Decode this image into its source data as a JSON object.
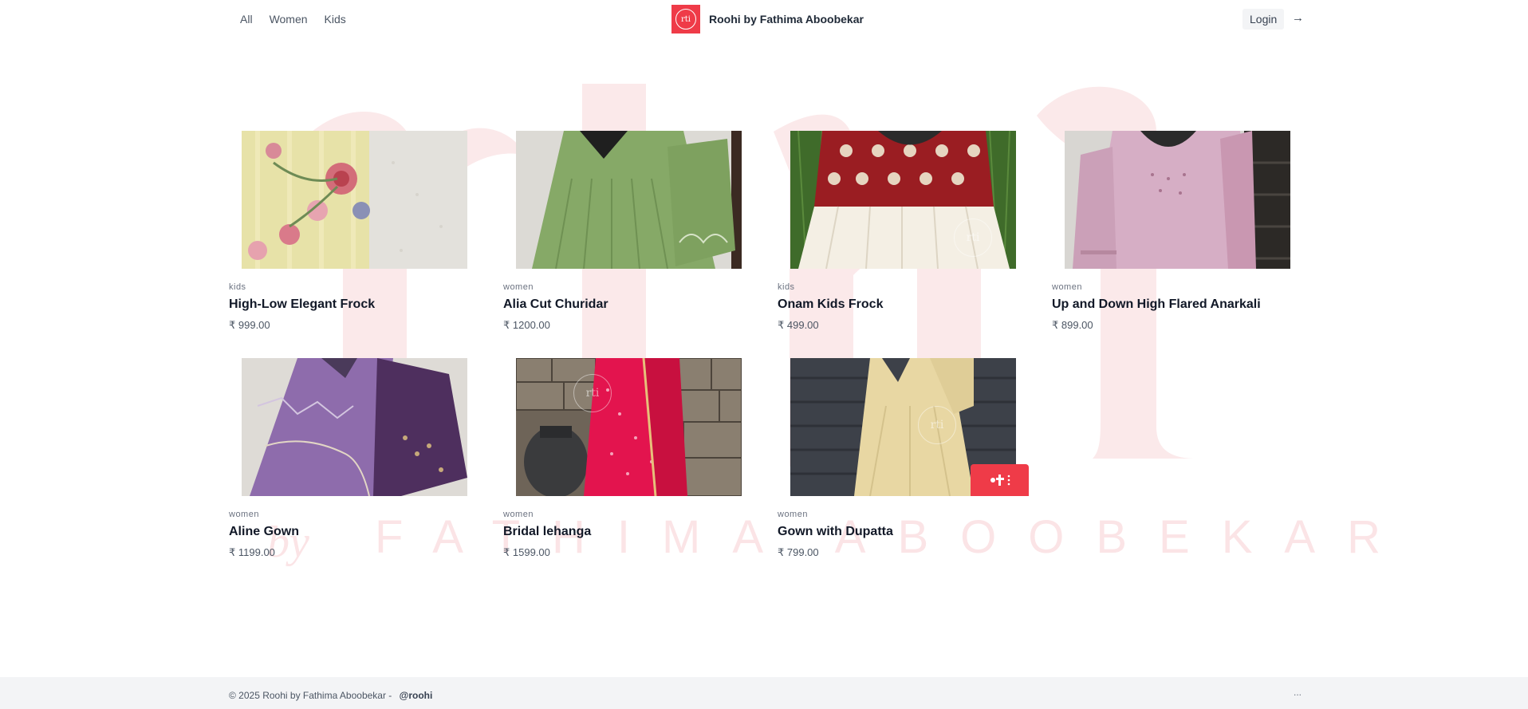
{
  "header": {
    "nav": [
      "All",
      "Women",
      "Kids"
    ],
    "logo_mark": "rti",
    "brand": "Roohi by Fathima Aboobekar",
    "login_label": "Login",
    "login_arrow": "→"
  },
  "watermark": {
    "text": "FATHIMA ABOOBEKAR",
    "by": "by"
  },
  "products": [
    {
      "category": "kids",
      "title": "High-Low Elegant Frock",
      "price": "₹ 999.00"
    },
    {
      "category": "women",
      "title": "Alia Cut Churidar",
      "price": "₹ 1200.00"
    },
    {
      "category": "kids",
      "title": "Onam Kids Frock",
      "price": "₹ 499.00"
    },
    {
      "category": "women",
      "title": "Up and Down High Flared Anarkali",
      "price": "₹ 899.00"
    },
    {
      "category": "women",
      "title": "Aline Gown",
      "price": "₹ 1199.00"
    },
    {
      "category": "women",
      "title": "Bridal lehanga",
      "price": "₹ 1599.00"
    },
    {
      "category": "women",
      "title": "Gown with Dupatta",
      "price": "₹ 799.00"
    }
  ],
  "footer": {
    "copyright": "© 2025 Roohi by Fathima Aboobekar -",
    "handle": "@roohi",
    "dots": "..."
  },
  "colors": {
    "brand_red": "#ef3b48",
    "watermark_pink": "#fbe4e6",
    "footer_bg": "#f3f4f6"
  }
}
